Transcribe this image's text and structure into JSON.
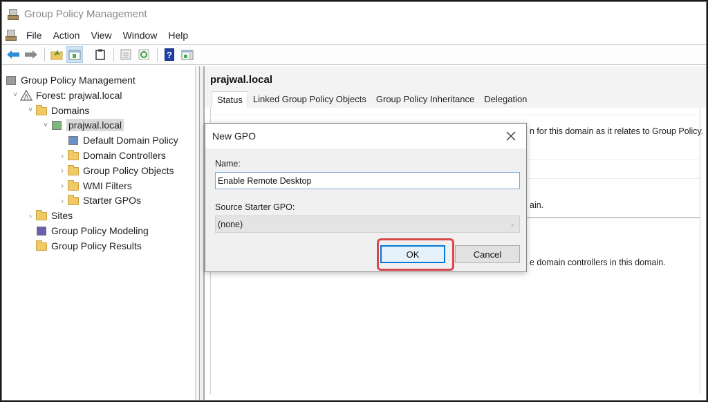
{
  "window": {
    "title": "Group Policy Management"
  },
  "menu": {
    "items": [
      "File",
      "Action",
      "View",
      "Window",
      "Help"
    ]
  },
  "toolbar": {
    "buttons": [
      {
        "icon": "back-arrow-icon"
      },
      {
        "icon": "forward-arrow-icon"
      },
      {
        "icon": "up-folder-icon"
      },
      {
        "icon": "show-hide-console-tree-icon"
      },
      {
        "icon": "clipboard-icon"
      },
      {
        "icon": "export-list-icon"
      },
      {
        "icon": "refresh-icon"
      },
      {
        "icon": "help-icon"
      },
      {
        "icon": "show-action-pane-icon"
      }
    ]
  },
  "tree": {
    "items": [
      {
        "label": "Group Policy Management",
        "level": 0,
        "expander": "",
        "icon": "gpm-console-icon"
      },
      {
        "label": "Forest: prajwal.local",
        "level": 1,
        "expander": "expanded",
        "icon": "forest-icon"
      },
      {
        "label": "Domains",
        "level": 2,
        "expander": "expanded",
        "icon": "domains-icon"
      },
      {
        "label": "prajwal.local",
        "level": 3,
        "expander": "expanded",
        "icon": "domain-icon",
        "selected": true
      },
      {
        "label": "Default Domain Policy",
        "level": 4,
        "expander": "",
        "icon": "gpo-link-icon"
      },
      {
        "label": "Domain Controllers",
        "level": 4,
        "expander": "collapsed",
        "icon": "ou-folder-icon"
      },
      {
        "label": "Group Policy Objects",
        "level": 4,
        "expander": "collapsed",
        "icon": "gpo-folder-icon"
      },
      {
        "label": "WMI Filters",
        "level": 4,
        "expander": "collapsed",
        "icon": "wmi-folder-icon"
      },
      {
        "label": "Starter GPOs",
        "level": 4,
        "expander": "collapsed",
        "icon": "starter-gpo-folder-icon"
      },
      {
        "label": "Sites",
        "level": 2,
        "expander": "collapsed",
        "icon": "sites-icon"
      },
      {
        "label": "Group Policy Modeling",
        "level": 2,
        "expander": "",
        "icon": "modeling-icon"
      },
      {
        "label": "Group Policy Results",
        "level": 2,
        "expander": "",
        "icon": "results-icon"
      }
    ]
  },
  "main": {
    "title": "prajwal.local",
    "tabs": [
      {
        "label": "Status",
        "active": true
      },
      {
        "label": "Linked Group Policy Objects",
        "active": false
      },
      {
        "label": "Group Policy Inheritance",
        "active": false
      },
      {
        "label": "Delegation",
        "active": false
      }
    ],
    "status_lines": [
      "n for this domain as it relates to Group Policy.",
      "ain.",
      "e domain controllers in this domain."
    ]
  },
  "dialog": {
    "title": "New GPO",
    "name_label": "Name:",
    "name_value": "Enable Remote Desktop",
    "source_label": "Source Starter GPO:",
    "source_value": "(none)",
    "ok_label": "OK",
    "cancel_label": "Cancel",
    "highlight_color": "#d9474b"
  }
}
